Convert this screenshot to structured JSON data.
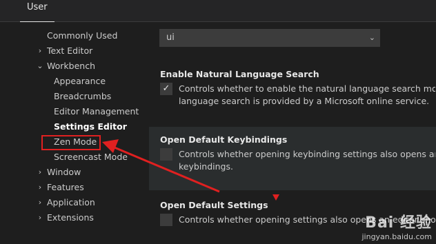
{
  "header": {
    "tab_user": "User"
  },
  "toc": {
    "items": [
      {
        "label": "Commonly Used",
        "chevron": ""
      },
      {
        "label": "Text Editor",
        "chevron": "›"
      },
      {
        "label": "Workbench",
        "chevron": "⌄"
      },
      {
        "label": "Appearance",
        "chevron": ""
      },
      {
        "label": "Breadcrumbs",
        "chevron": ""
      },
      {
        "label": "Editor Management",
        "chevron": ""
      },
      {
        "label": "Settings Editor",
        "chevron": ""
      },
      {
        "label": "Zen Mode",
        "chevron": ""
      },
      {
        "label": "Screencast Mode",
        "chevron": ""
      },
      {
        "label": "Window",
        "chevron": "›"
      },
      {
        "label": "Features",
        "chevron": "›"
      },
      {
        "label": "Application",
        "chevron": "›"
      },
      {
        "label": "Extensions",
        "chevron": "›"
      }
    ]
  },
  "search": {
    "value": "ui",
    "dropdown_icon": "⌄"
  },
  "settings": [
    {
      "title": "Enable Natural Language Search",
      "desc1": "Controls whether to enable the natural language search mode for",
      "desc2": "language search is provided by a Microsoft online service.",
      "checked": true,
      "check_glyph": "✓"
    },
    {
      "title": "Open Default Keybindings",
      "desc1": "Controls whether opening keybinding settings also opens an edit",
      "desc2": "keybindings.",
      "checked": false,
      "check_glyph": ""
    },
    {
      "title": "Open Default Settings",
      "desc1": "Controls whether opening settings also opens an editor showing",
      "desc2": "",
      "checked": false,
      "check_glyph": ""
    }
  ],
  "annotation_color": "#e02020",
  "watermark": {
    "logo": "Bai 经验",
    "url": "jingyan.baidu.com"
  }
}
